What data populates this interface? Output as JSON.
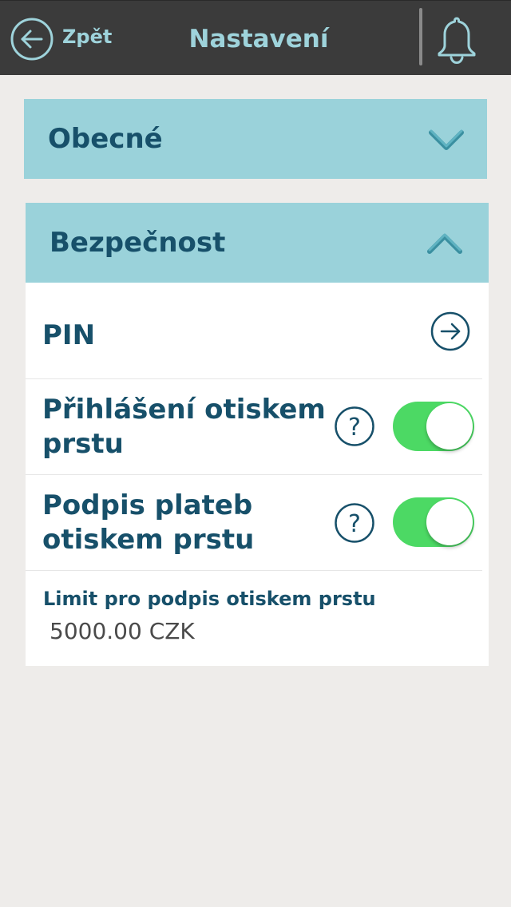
{
  "header": {
    "back_label": "Zpět",
    "title": "Nastavení",
    "back_icon": "arrow-left-circle-icon",
    "bell_icon": "bell-icon"
  },
  "sections": {
    "general": {
      "label": "Obecné",
      "state": "collapsed",
      "chevron_icon": "chevron-down-icon"
    },
    "security": {
      "label": "Bezpečnost",
      "state": "expanded",
      "chevron_icon": "chevron-up-icon"
    }
  },
  "security": {
    "pin": {
      "label": "PIN",
      "icon": "arrow-right-circle-icon"
    },
    "fingerprint_login": {
      "label_line1": "Přihlášení otiskem",
      "label_line2": "prstu",
      "help_icon": "question-circle-icon",
      "enabled": true
    },
    "fingerprint_payment": {
      "label_line1": "Podpis plateb",
      "label_line2": "otiskem prstu",
      "help_icon": "question-circle-icon",
      "enabled": true
    },
    "limit": {
      "label": "Limit pro podpis otiskem prstu",
      "value": "5000.00 CZK"
    }
  },
  "colors": {
    "header_bg": "#3b3b3b",
    "accent_text": "#9ed3db",
    "section_bg": "#9ad2da",
    "primary_text": "#17506a",
    "toggle_on": "#4cd964",
    "page_bg": "#eeecea"
  }
}
